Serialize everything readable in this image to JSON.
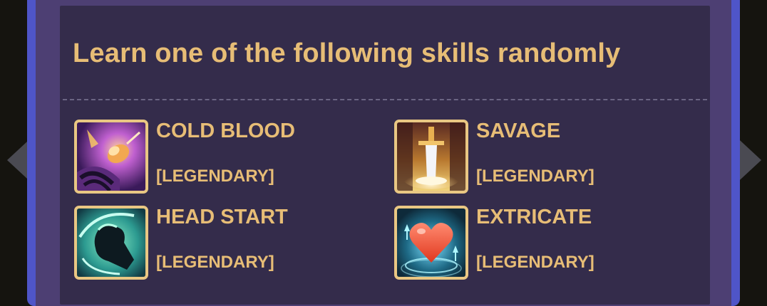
{
  "panel": {
    "title": "Learn one of the following skills randomly"
  },
  "skills": [
    {
      "name": "COLD BLOOD",
      "rarity": "[LEGENDARY]",
      "icon": "cold-blood-icon"
    },
    {
      "name": "SAVAGE",
      "rarity": "[LEGENDARY]",
      "icon": "savage-icon"
    },
    {
      "name": "HEAD START",
      "rarity": "[LEGENDARY]",
      "icon": "head-start-icon"
    },
    {
      "name": "EXTRICATE",
      "rarity": "[LEGENDARY]",
      "icon": "extricate-icon"
    }
  ],
  "colors": {
    "title_gold": "#e7bd76",
    "panel_bg": "#342c4b",
    "frame_blue": "#4f55c8",
    "icon_border": "#e9c783"
  }
}
